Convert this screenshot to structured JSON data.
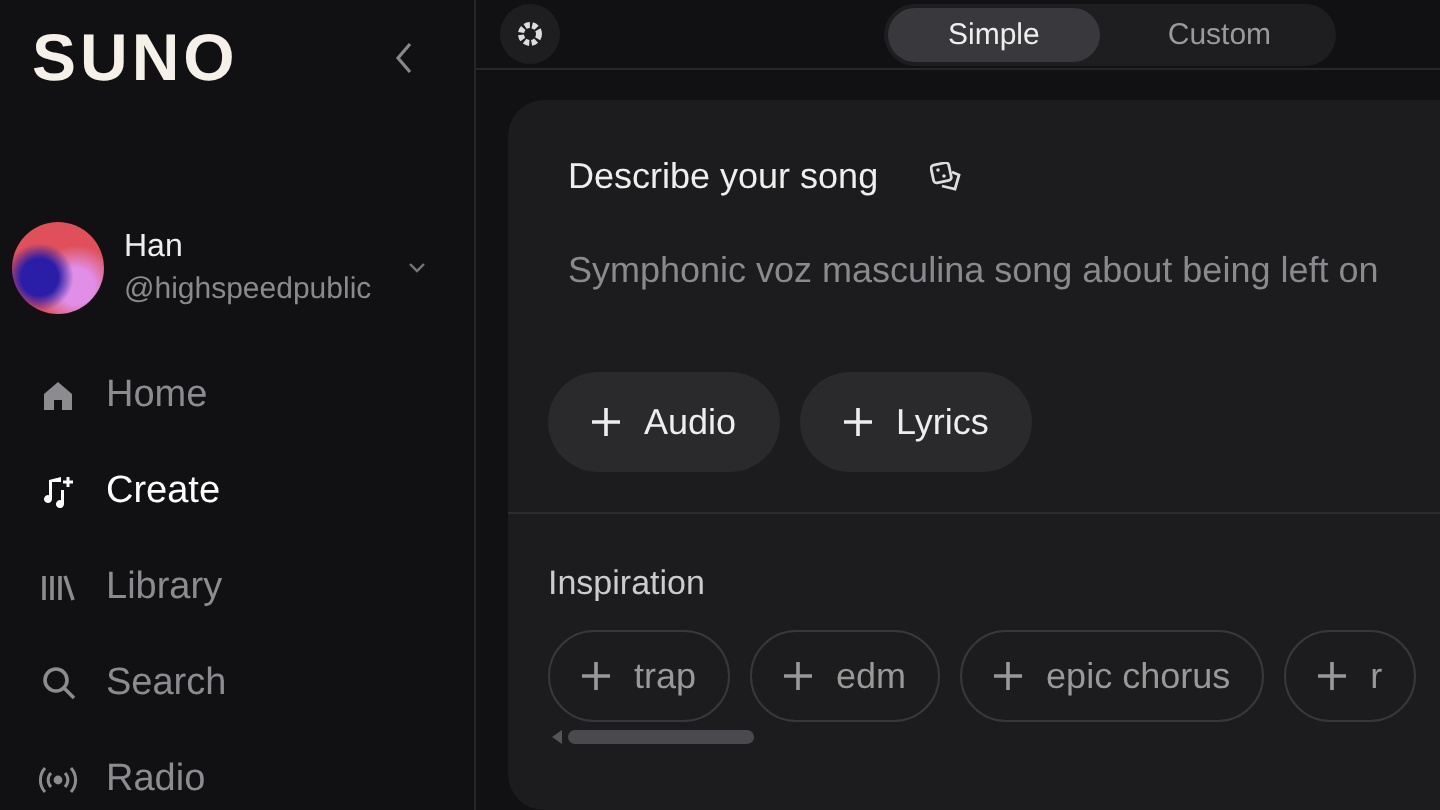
{
  "logo": "SUNO",
  "sidebar": {
    "profile": {
      "name": "Han",
      "handle": "@highspeedpublic"
    },
    "nav": [
      {
        "label": "Home",
        "kind": "home",
        "selected": false
      },
      {
        "label": "Create",
        "kind": "create",
        "selected": true
      },
      {
        "label": "Library",
        "kind": "library",
        "selected": false
      },
      {
        "label": "Search",
        "kind": "search",
        "selected": false
      },
      {
        "label": "Radio",
        "kind": "radio",
        "selected": false
      }
    ]
  },
  "mode_toggle": [
    {
      "label": "Simple",
      "selected": true
    },
    {
      "label": "Custom",
      "selected": false
    }
  ],
  "prompt": {
    "title": "Describe your song",
    "placeholder": "Symphonic voz masculina song about being left on",
    "buttons": [
      "Audio",
      "Lyrics"
    ]
  },
  "inspiration": {
    "title": "Inspiration",
    "chips": [
      "trap",
      "edm",
      "epic chorus",
      "r"
    ]
  }
}
